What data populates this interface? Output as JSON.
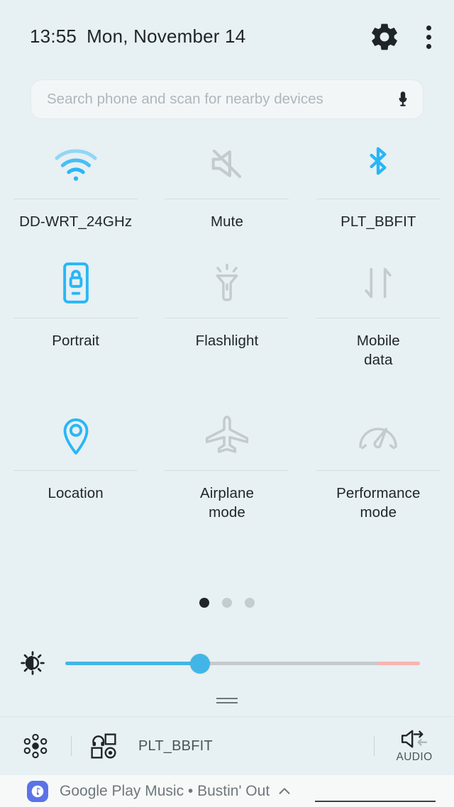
{
  "header": {
    "time": "13:55",
    "date": "Mon, November 14",
    "settings_icon": "gear-icon",
    "overflow_icon": "kebab-menu-icon"
  },
  "search": {
    "placeholder": "Search phone and scan for nearby devices",
    "value": "",
    "mic_icon": "microphone-icon"
  },
  "tiles": [
    [
      {
        "label": "DD-WRT_24GHz",
        "icon": "wifi-icon",
        "state": "on",
        "color": "#29b6f6"
      },
      {
        "label": "Mute",
        "icon": "volume-mute-icon",
        "state": "off",
        "color": "#c3cbcd"
      },
      {
        "label": "PLT_BBFIT",
        "icon": "bluetooth-icon",
        "state": "on",
        "color": "#29b6f6"
      }
    ],
    [
      {
        "label": "Portrait",
        "icon": "rotation-lock-icon",
        "state": "on",
        "color": "#29b6f6"
      },
      {
        "label": "Flashlight",
        "icon": "flashlight-icon",
        "state": "off",
        "color": "#c3cbcd"
      },
      {
        "label": "Mobile\ndata",
        "icon": "mobile-data-icon",
        "state": "off",
        "color": "#c3cbcd"
      }
    ],
    [
      {
        "label": "Location",
        "icon": "location-pin-icon",
        "state": "on",
        "color": "#29b6f6"
      },
      {
        "label": "Airplane\nmode",
        "icon": "airplane-icon",
        "state": "off",
        "color": "#c3cbcd"
      },
      {
        "label": "Performance\nmode",
        "icon": "speedometer-icon",
        "state": "off",
        "color": "#c3cbcd"
      }
    ]
  ],
  "pager": {
    "pages": 3,
    "current": 1
  },
  "brightness": {
    "icon": "brightness-sun-icon",
    "percent": 38,
    "warn_start_percent": 88,
    "fill_color": "#41b6e6",
    "track_color": "#c5cbcd",
    "warn_color": "#f7b4ae"
  },
  "drag_handle": {
    "name": "panel-drag-handle"
  },
  "bottom_bar": {
    "quick_connect_icon": "quick-connect-hub-icon",
    "devices_icon": "connected-devices-icon",
    "device_name": "PLT_BBFIT",
    "audio_icon": "audio-output-switch-icon",
    "audio_label": "AUDIO"
  },
  "notification": {
    "app_icon": "google-play-music-icon",
    "text": "Google Play Music • Bustin' Out",
    "expand_icon": "chevron-up-icon"
  }
}
